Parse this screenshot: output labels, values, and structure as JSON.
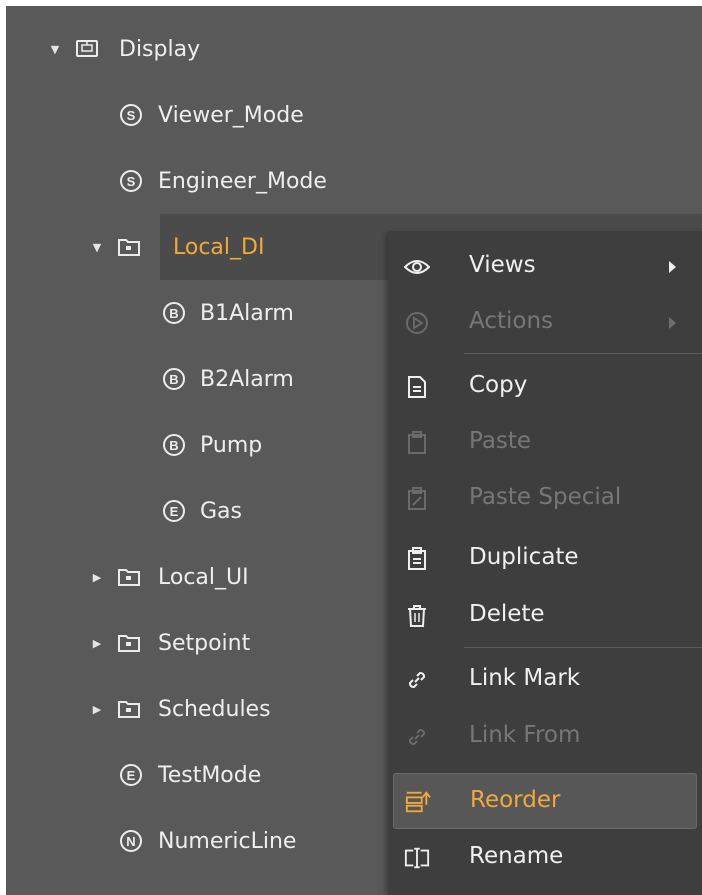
{
  "tree": {
    "items": [
      {
        "label": "Display",
        "icon": "display-icon",
        "expanded": true
      },
      {
        "label": "Viewer_Mode",
        "badge": "S"
      },
      {
        "label": "Engineer_Mode",
        "badge": "S"
      },
      {
        "label": "Local_DI",
        "icon": "folder-icon",
        "expanded": true,
        "selected": true
      },
      {
        "label": "B1Alarm",
        "badge": "B"
      },
      {
        "label": "B2Alarm",
        "badge": "B"
      },
      {
        "label": "Pump",
        "badge": "B"
      },
      {
        "label": "Gas",
        "badge": "E"
      },
      {
        "label": "Local_UI",
        "icon": "folder-icon",
        "expanded": false
      },
      {
        "label": "Setpoint",
        "icon": "folder-icon",
        "expanded": false
      },
      {
        "label": "Schedules",
        "icon": "folder-icon",
        "expanded": false
      },
      {
        "label": "TestMode",
        "badge": "E"
      },
      {
        "label": "NumericLine",
        "badge": "N"
      }
    ]
  },
  "context_menu": {
    "items": [
      {
        "label": "Views",
        "icon": "eye-icon",
        "enabled": true,
        "submenu": true
      },
      {
        "label": "Actions",
        "icon": "play-circle-icon",
        "enabled": false,
        "submenu": true
      },
      {
        "label": "Copy",
        "icon": "copy-icon",
        "enabled": true
      },
      {
        "label": "Paste",
        "icon": "paste-icon",
        "enabled": false
      },
      {
        "label": "Paste Special",
        "icon": "paste-special-icon",
        "enabled": false
      },
      {
        "label": "Duplicate",
        "icon": "duplicate-icon",
        "enabled": true
      },
      {
        "label": "Delete",
        "icon": "trash-icon",
        "enabled": true
      },
      {
        "label": "Link Mark",
        "icon": "link-icon",
        "enabled": true
      },
      {
        "label": "Link From",
        "icon": "link-from-icon",
        "enabled": false
      },
      {
        "label": "Reorder",
        "icon": "reorder-icon",
        "enabled": true,
        "highlighted": true
      },
      {
        "label": "Rename",
        "icon": "rename-icon",
        "enabled": true
      }
    ]
  },
  "colors": {
    "background": "#595959",
    "menu_background": "#3e3e3e",
    "accent": "#f2a93b",
    "text": "#eeeeee",
    "disabled_text": "#777777"
  }
}
